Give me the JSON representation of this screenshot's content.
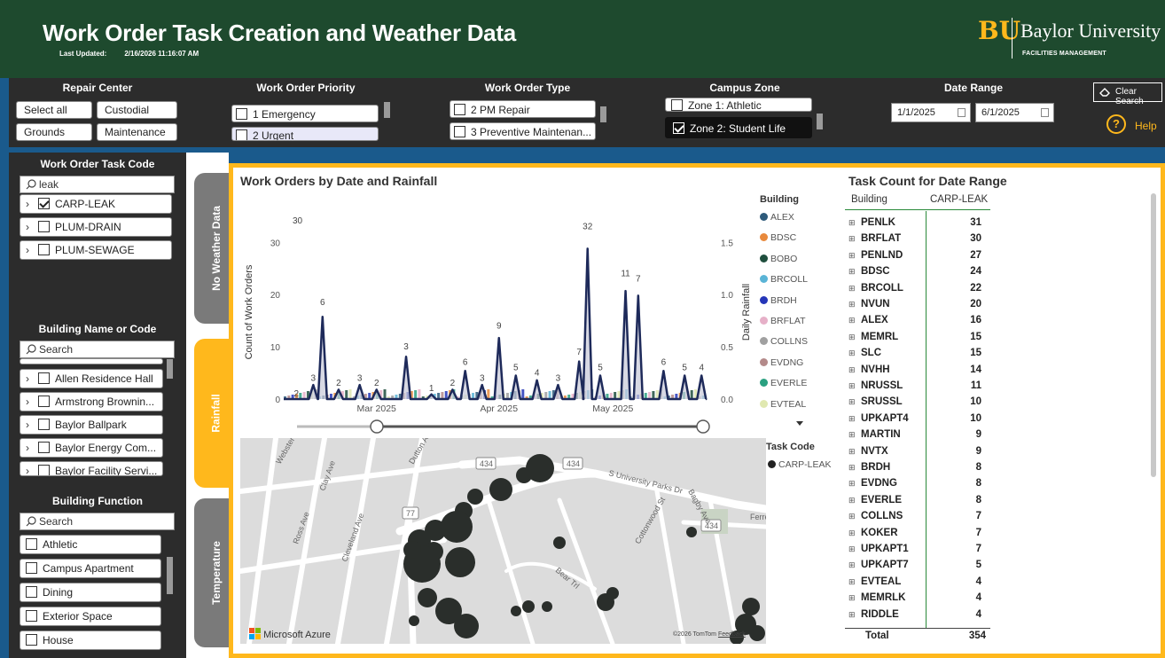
{
  "header": {
    "title": "Work Order Task Creation and Weather Data",
    "last_updated_label": "Last Updated:",
    "last_updated_value": "2/16/2026 11:16:07 AM",
    "logo_monogram": "BU",
    "logo_name": "Baylor University",
    "logo_sub": "FACILITIES MANAGEMENT"
  },
  "filters": {
    "repair_center": {
      "title": "Repair Center",
      "options": [
        "Select all",
        "Custodial",
        "Grounds",
        "Maintenance"
      ]
    },
    "priority": {
      "title": "Work Order Priority",
      "options": [
        "1 Emergency",
        "2 Urgent"
      ]
    },
    "type": {
      "title": "Work Order Type",
      "options": [
        "2 PM Repair",
        "3 Preventive Maintenan..."
      ]
    },
    "zone": {
      "title": "Campus Zone",
      "options": [
        "Zone 1: Athletic",
        "Zone 2: Student Life"
      ],
      "selected": "Zone 2: Student Life"
    },
    "date_range": {
      "title": "Date Range",
      "start": "1/1/2025",
      "end": "6/1/2025"
    },
    "clear_label": "Clear Search",
    "help_label": "Help"
  },
  "left": {
    "task_code": {
      "title": "Work Order Task Code",
      "search_value": "leak",
      "items": [
        "CARP-LEAK",
        "PLUM-DRAIN",
        "PLUM-SEWAGE"
      ]
    },
    "building": {
      "title": "Building Name or Code",
      "placeholder": "Search",
      "items": [
        "Allen Residence Hall",
        "Armstrong Brownin...",
        "Baylor Ballpark",
        "Baylor Energy Com...",
        "Baylor Facility Servi..."
      ]
    },
    "function": {
      "title": "Building Function",
      "placeholder": "Search",
      "items": [
        "Athletic",
        "Campus Apartment",
        "Dining",
        "Exterior Space",
        "House"
      ]
    }
  },
  "tabs": [
    "No Weather Data",
    "Rainfall",
    "Temperature"
  ],
  "chart_data": {
    "type": "line",
    "title": "Work Orders by Date and Rainfall",
    "xlabel": "",
    "ylabel": "Count of Work Orders",
    "ylabel_right": "Daily Rainfall",
    "x_ticks": [
      "Mar 2025",
      "Apr 2025",
      "May 2025"
    ],
    "y_ticks": [
      0,
      10,
      20,
      30
    ],
    "y2_ticks": [
      "0.0",
      "0.5",
      "1.0",
      "1.5"
    ],
    "ylim": [
      0,
      36
    ],
    "y2lim": [
      0,
      1.8
    ],
    "peaks": [
      {
        "x": 0.03,
        "y": 0,
        "label": "2"
      },
      {
        "x": 0.07,
        "y": 3,
        "label": "3"
      },
      {
        "x": 0.092,
        "y": 17.5,
        "label": "6"
      },
      {
        "x": 0.13,
        "y": 2,
        "label": "2"
      },
      {
        "x": 0.18,
        "y": 3,
        "label": "3"
      },
      {
        "x": 0.22,
        "y": 2,
        "label": "2"
      },
      {
        "x": 0.29,
        "y": 9,
        "label": "3"
      },
      {
        "x": 0.35,
        "y": 1,
        "label": "1"
      },
      {
        "x": 0.4,
        "y": 2,
        "label": "2"
      },
      {
        "x": 0.43,
        "y": 6,
        "label": "6"
      },
      {
        "x": 0.47,
        "y": 3,
        "label": "3"
      },
      {
        "x": 0.51,
        "y": 13,
        "label": "9"
      },
      {
        "x": 0.55,
        "y": 5,
        "label": "5"
      },
      {
        "x": 0.6,
        "y": 4,
        "label": "4"
      },
      {
        "x": 0.65,
        "y": 3,
        "label": "3"
      },
      {
        "x": 0.7,
        "y": 8,
        "label": "7"
      },
      {
        "x": 0.72,
        "y": 32,
        "label": "32"
      },
      {
        "x": 0.75,
        "y": 5,
        "label": "5"
      },
      {
        "x": 0.81,
        "y": 23,
        "label": "11"
      },
      {
        "x": 0.84,
        "y": 22,
        "label": "7"
      },
      {
        "x": 0.9,
        "y": 6,
        "label": "6"
      },
      {
        "x": 0.95,
        "y": 5,
        "label": "5"
      },
      {
        "x": 0.99,
        "y": 5,
        "label": "4"
      }
    ],
    "side_labels": {
      "y30": "30"
    },
    "legend_title": "Building",
    "legend": [
      {
        "name": "ALEX",
        "color": "#2e5a7a"
      },
      {
        "name": "BDSC",
        "color": "#e8893c"
      },
      {
        "name": "BOBO",
        "color": "#1f4e3d"
      },
      {
        "name": "BRCOLL",
        "color": "#5ab4d6"
      },
      {
        "name": "BRDH",
        "color": "#2536b8"
      },
      {
        "name": "BRFLAT",
        "color": "#e6b0c8"
      },
      {
        "name": "COLLNS",
        "color": "#a0a0a0"
      },
      {
        "name": "EVDNG",
        "color": "#b48a8a"
      },
      {
        "name": "EVERLE",
        "color": "#2aa080"
      },
      {
        "name": "EVTEAL",
        "color": "#e0e8b0"
      }
    ]
  },
  "map": {
    "legend_title": "Task Code",
    "legend_item": "CARP-LEAK",
    "attribution": "Microsoft Azure",
    "copyright": "©2026 TomTom",
    "feedback": "Feedback",
    "road_labels": [
      "434",
      "434",
      "77",
      "434",
      "S University Parks Dr",
      "Bear Trl",
      "Cottonwood St",
      "Bagby Ave",
      "Clay Ave",
      "Ross Ave",
      "Cleveland Ave",
      "Webster Ave",
      "Dutton Ave",
      "Ferrell Cem"
    ]
  },
  "table": {
    "title": "Task Count for Date Range",
    "col1": "Building",
    "col2": "CARP-LEAK",
    "rows": [
      [
        "PENLK",
        "31"
      ],
      [
        "BRFLAT",
        "30"
      ],
      [
        "PENLND",
        "27"
      ],
      [
        "BDSC",
        "24"
      ],
      [
        "BRCOLL",
        "22"
      ],
      [
        "NVUN",
        "20"
      ],
      [
        "ALEX",
        "16"
      ],
      [
        "MEMRL",
        "15"
      ],
      [
        "SLC",
        "15"
      ],
      [
        "NVHH",
        "14"
      ],
      [
        "NRUSSL",
        "11"
      ],
      [
        "SRUSSL",
        "10"
      ],
      [
        "UPKAPT4",
        "10"
      ],
      [
        "MARTIN",
        "9"
      ],
      [
        "NVTX",
        "9"
      ],
      [
        "BRDH",
        "8"
      ],
      [
        "EVDNG",
        "8"
      ],
      [
        "EVERLE",
        "8"
      ],
      [
        "COLLNS",
        "7"
      ],
      [
        "KOKER",
        "7"
      ],
      [
        "UPKAPT1",
        "7"
      ],
      [
        "UPKAPT7",
        "5"
      ],
      [
        "EVTEAL",
        "4"
      ],
      [
        "MEMRLK",
        "4"
      ],
      [
        "RIDDLE",
        "4"
      ]
    ],
    "total_label": "Total",
    "total_value": "354"
  }
}
